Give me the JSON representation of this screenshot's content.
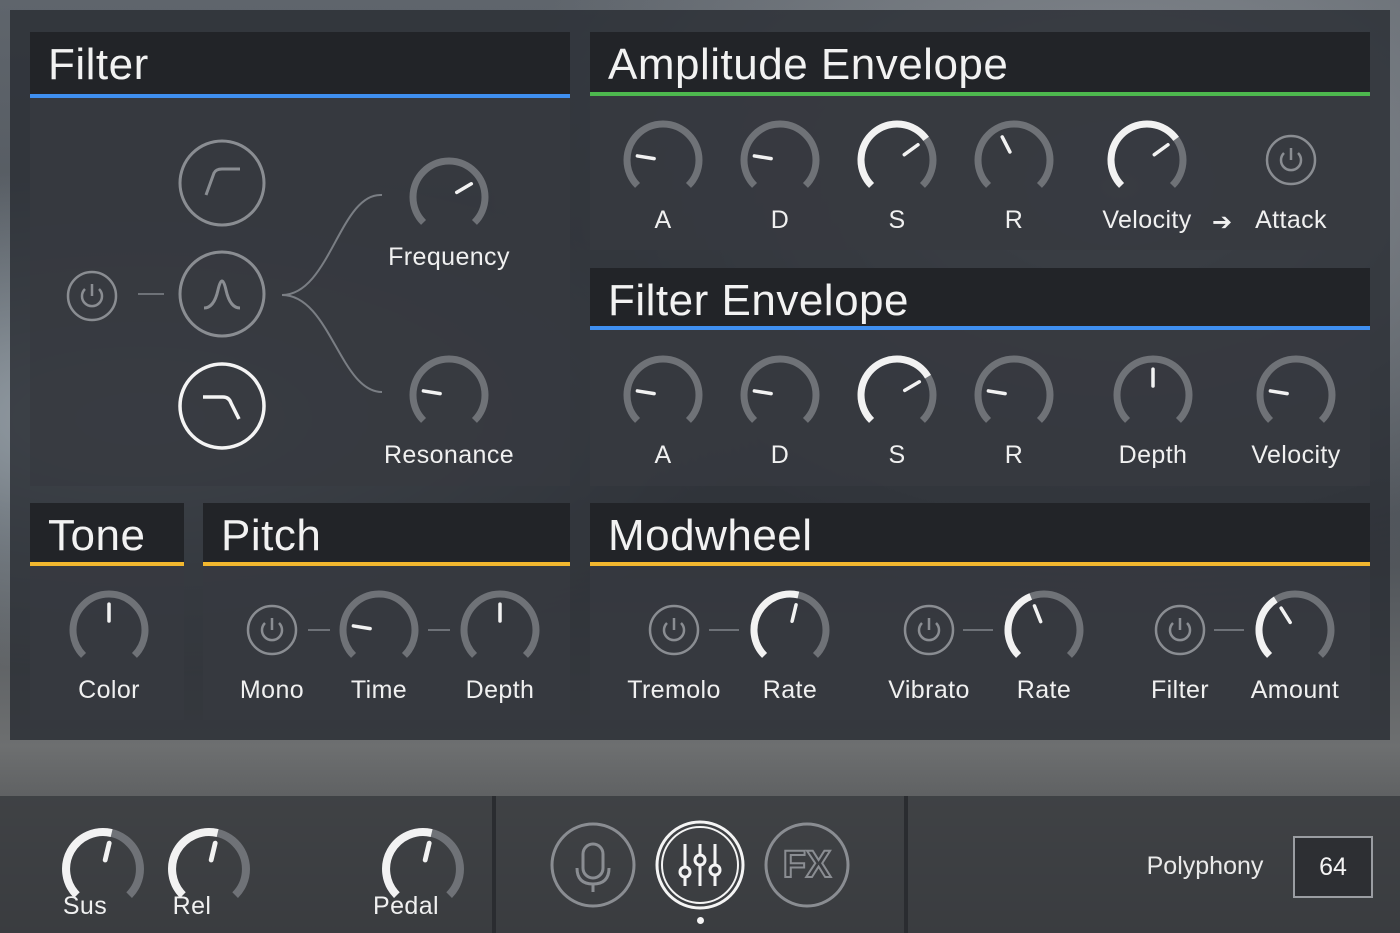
{
  "colors": {
    "filter_accent": "#3f8ff0",
    "amp_accent": "#4db84e",
    "tone_accent": "#f2b72f",
    "knob_track": "#6f7277",
    "knob_active": "#f2f2f2"
  },
  "filter": {
    "title": "Filter",
    "power_icon": "power-icon",
    "types": [
      {
        "name": "highpass-filter-button",
        "icon": "highpass-icon",
        "selected": false
      },
      {
        "name": "bandpass-filter-button",
        "icon": "bandpass-icon",
        "selected": false
      },
      {
        "name": "lowpass-filter-button",
        "icon": "lowpass-icon",
        "selected": true
      }
    ],
    "frequency_label": "Frequency",
    "frequency_value": 0.72,
    "resonance_label": "Resonance",
    "resonance_value": 0.2
  },
  "amp_env": {
    "title": "Amplitude Envelope",
    "knobs": [
      {
        "label": "A",
        "value": 0.2
      },
      {
        "label": "D",
        "value": 0.2
      },
      {
        "label": "S",
        "value": 0.7
      },
      {
        "label": "R",
        "value": 0.4
      }
    ],
    "velocity_label": "Velocity",
    "velocity_value": 0.7,
    "arrow": "➔",
    "attack_label": "Attack"
  },
  "filter_env": {
    "title": "Filter Envelope",
    "knobs": [
      {
        "label": "A",
        "value": 0.2
      },
      {
        "label": "D",
        "value": 0.2
      },
      {
        "label": "S",
        "value": 0.72
      },
      {
        "label": "R",
        "value": 0.2
      },
      {
        "label": "Depth",
        "value": 0.5
      },
      {
        "label": "Velocity",
        "value": 0.2
      }
    ]
  },
  "tone": {
    "title": "Tone",
    "color_label": "Color",
    "color_value": 0.5
  },
  "pitch": {
    "title": "Pitch",
    "mono_label": "Mono",
    "time_label": "Time",
    "time_value": 0.2,
    "depth_label": "Depth",
    "depth_value": 0.5
  },
  "modwheel": {
    "title": "Modwheel",
    "tremolo_label": "Tremolo",
    "tremolo_rate_label": "Rate",
    "tremolo_rate_value": 0.55,
    "vibrato_label": "Vibrato",
    "vibrato_rate_label": "Rate",
    "vibrato_rate_value": 0.42,
    "filter_label": "Filter",
    "amount_label": "Amount",
    "amount_value": 0.38
  },
  "bottom": {
    "sus_label": "Sus",
    "sus_value": 0.55,
    "rel_label": "Rel",
    "rel_value": 0.55,
    "pedal_label": "Pedal",
    "pedal_value": 0.55,
    "nav": [
      {
        "icon": "microphone-icon",
        "active": false
      },
      {
        "icon": "mixer-sliders-icon",
        "active": true
      },
      {
        "icon": "fx-icon",
        "label": "FX",
        "active": false
      }
    ],
    "polyphony_label": "Polyphony",
    "polyphony_value": "64"
  }
}
